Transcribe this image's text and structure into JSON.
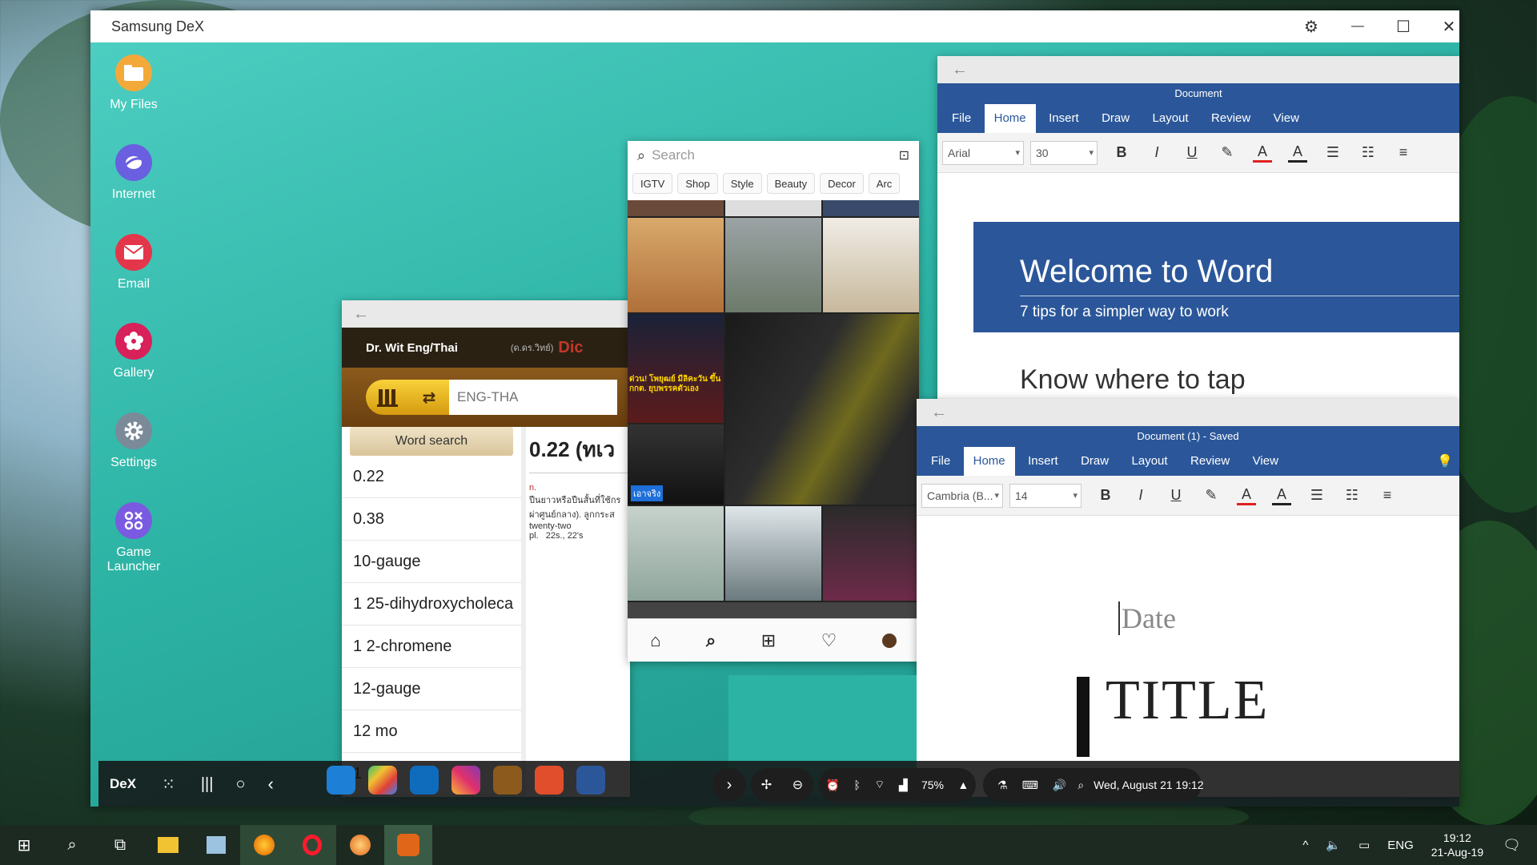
{
  "dex_window": {
    "title": "Samsung DeX",
    "controls": {
      "settings": "⚙",
      "minimize": "—",
      "maximize": "☐",
      "close": "✕"
    }
  },
  "desktop_icons": [
    {
      "label": "My Files",
      "icon": "folder-icon",
      "color": "#f3a93a"
    },
    {
      "label": "Internet",
      "icon": "internet-icon",
      "color": "#6a5fe0"
    },
    {
      "label": "Email",
      "icon": "email-icon",
      "color": "#e4364a"
    },
    {
      "label": "Gallery",
      "icon": "gallery-icon",
      "color": "#d8205a"
    },
    {
      "label": "Settings",
      "icon": "settings-gear-icon",
      "color": "#7b8a99"
    },
    {
      "label": "Game Launcher",
      "icon": "game-launcher-icon",
      "color": "#7a5ae0"
    }
  ],
  "dictionary": {
    "app_title": "Dr. Wit Eng/Thai",
    "header_right": "(ด.ดร.วิทย์)",
    "header_right_brand": "Dic",
    "search_placeholder": "ENG-THA",
    "word_search_label": "Word search",
    "words": [
      "0.22",
      "0.38",
      "10-gauge",
      "1 25-dihydroxycholeca",
      "1 2-chromene",
      "12-gauge",
      "12 mo",
      "1"
    ],
    "entry_heading": "0.22 (ทเว",
    "entry_pos": "n.",
    "entry_lines": [
      "ปืนยาวหรือปืนสั้นที่ใช้กร",
      "ผ่าศูนย์กลาง). ลูกกระส",
      "twenty-two"
    ],
    "entry_plural": "pl.   22s., 22's"
  },
  "instagram": {
    "search_placeholder": "Search",
    "chips": [
      "IGTV",
      "Shop",
      "Style",
      "Beauty",
      "Decor",
      "Arc"
    ],
    "news_caption": "ด่วน! โพยุฒย์ มีลิคะวัน ขึ้น กกต. ยุบพรรคตัวเอง",
    "news_caption2": "เอาจริง"
  },
  "word_doc1": {
    "title": "Document",
    "tabs": [
      "File",
      "Home",
      "Insert",
      "Draw",
      "Layout",
      "Review",
      "View"
    ],
    "active_tab": "Home",
    "font": "Arial",
    "size": "30",
    "banner_title": "Welcome to Word",
    "banner_sub": "7 tips for a simpler way to work",
    "heading": "Know where to tap"
  },
  "word_doc2": {
    "title": "Document (1) - Saved",
    "tabs": [
      "File",
      "Home",
      "Insert",
      "Draw",
      "Layout",
      "Review",
      "View"
    ],
    "active_tab": "Home",
    "font": "Cambria (B...",
    "size": "14",
    "date_placeholder": "Date",
    "title_placeholder": "TITLE"
  },
  "dex_taskbar": {
    "dex_label": "DeX",
    "battery": "75%",
    "datetime": "Wed, August 21 19:12"
  },
  "windows_taskbar": {
    "language": "ENG",
    "time": "19:12",
    "date": "21-Aug-19"
  },
  "colors": {
    "word_blue": "#2b579a",
    "dex_teal": "#2cb3a4"
  }
}
